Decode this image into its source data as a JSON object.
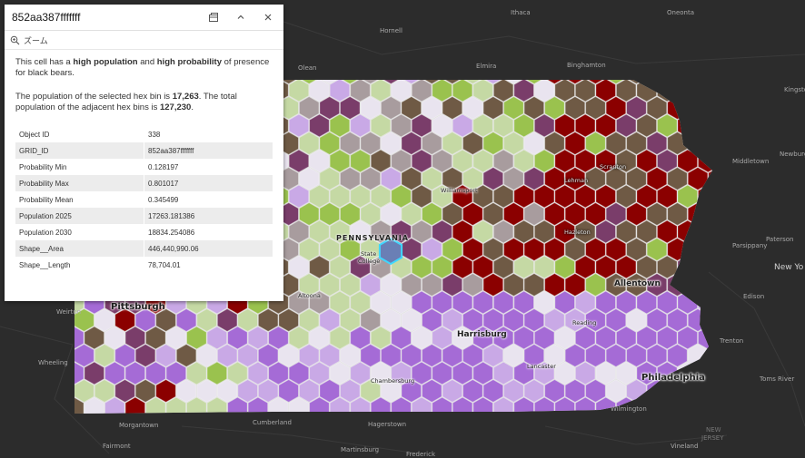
{
  "popup": {
    "title": "852aa387fffffff",
    "zoom_label": "ズーム",
    "description": {
      "p1_a": "This cell has a ",
      "p1_b": "high population",
      "p1_c": " and ",
      "p1_d": "high probability",
      "p1_e": " of presence for black bears.",
      "p2_a": "The population of the selected hex bin is ",
      "p2_b": "17,263",
      "p2_c": ". The total population of the adjacent hex bins is ",
      "p2_d": "127,230",
      "p2_e": "."
    },
    "attributes": [
      {
        "key": "Object ID",
        "value": "338"
      },
      {
        "key": "GRID_ID",
        "value": "852aa387fffffff"
      },
      {
        "key": "Probability Min",
        "value": "0.128197"
      },
      {
        "key": "Probability Max",
        "value": "0.801017"
      },
      {
        "key": "Probability Mean",
        "value": "0.345499"
      },
      {
        "key": "Population 2025",
        "value": "17263.181386"
      },
      {
        "key": "Population 2030",
        "value": "18834.254086"
      },
      {
        "key": "Shape__Area",
        "value": "446,440,990.06"
      },
      {
        "key": "Shape__Length",
        "value": "78,704.01"
      }
    ]
  },
  "basemap_places": {
    "ithaca": "Ithaca",
    "oneonta": "Oneonta",
    "hornell": "Hornell",
    "olean": "Olean",
    "elmira": "Elmira",
    "binghamton": "Binghamton",
    "kingston": "Kingsto",
    "newburgh": "Newburg",
    "middletown": "Middletown",
    "paterson": "Paterson",
    "parsippany": "Parsippany",
    "edison": "Edison",
    "trenton": "Trenton",
    "toms_river": "Toms River",
    "weirton": "Weirton",
    "wheeling": "Wheeling",
    "morgantown": "Morgantown",
    "fairmont": "Fairmont",
    "cumberland": "Cumberland",
    "hagerstown": "Hagerstown",
    "martinsburg": "Martinsburg",
    "frederick": "Frederick",
    "wilmington": "Wilmington",
    "vineland": "Vineland",
    "new_jersey_1": "NEW",
    "new_jersey_2": "JERSEY",
    "new_york_city": "New Yo"
  },
  "map_labels": {
    "state": "PENNSYLVANIA",
    "pittsburgh": "Pittsburgh",
    "harrisburg": "Harrisburg",
    "philadelphia": "Philadelphia",
    "allentown": "Allentown",
    "scranton": "Scranton",
    "williamsport": "Williamsport",
    "lehman": "Lehman",
    "hazleton": "Hazleton",
    "altoona": "Altoona",
    "state_college_1": "State",
    "state_college_2": "College",
    "reading": "Reading",
    "lancaster": "Lancaster",
    "chambersburg": "Chambersburg"
  },
  "legend_colors": {
    "high_high": "#8b0000",
    "high_mid": "#6f5a45",
    "mid_high": "#7a3d6a",
    "low_high": "#9ac24e",
    "low_mid": "#c5d9a4",
    "low_low": "#e9e4ef",
    "mid_low": "#c9a9e6",
    "high_low": "#a56bd6",
    "neutral": "#a89c9e",
    "selected_fill": "#6a7fb5",
    "selected_outline": "#3fd7ff"
  }
}
